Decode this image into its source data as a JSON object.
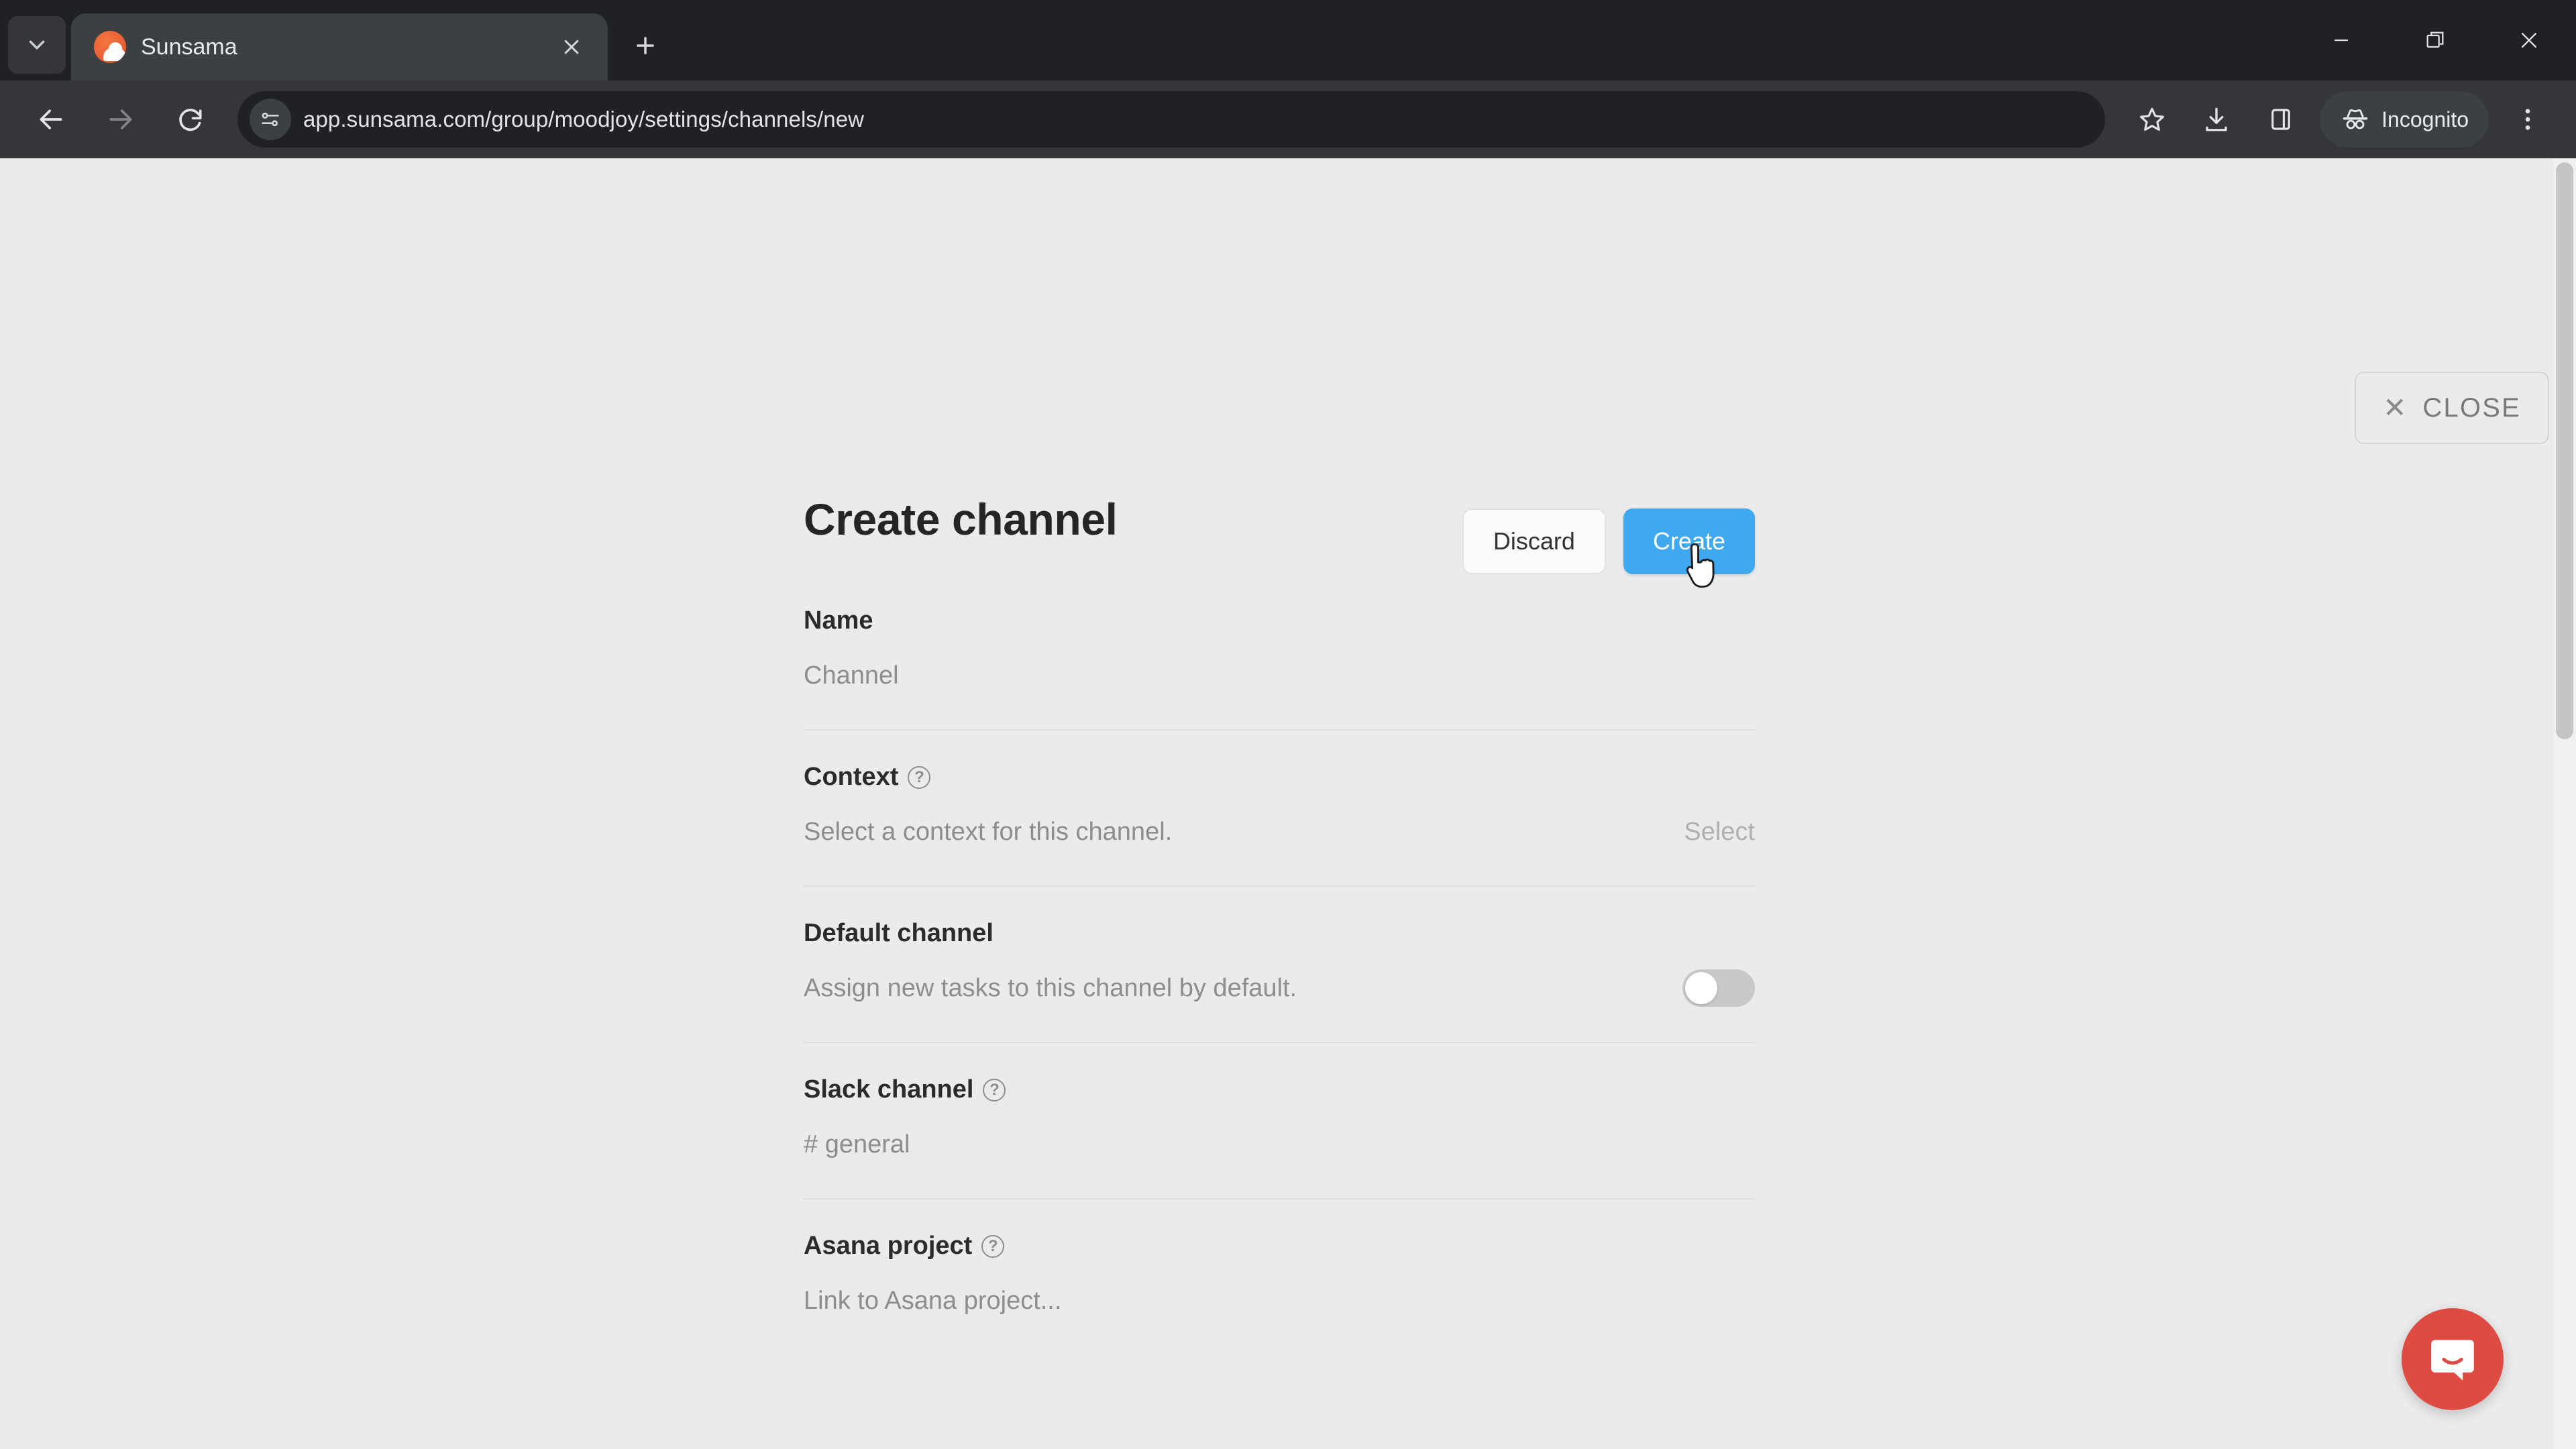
{
  "browser": {
    "tab": {
      "title": "Sunsama",
      "favicon": "sunsama-logo-icon"
    },
    "tab_search_icon": "chevron-down-icon",
    "new_tab_icon": "plus-icon",
    "tab_close_icon": "close-icon",
    "window": {
      "minimize": "minimize-icon",
      "maximize": "restore-icon",
      "close": "close-icon"
    },
    "nav": {
      "back": "back-arrow-icon",
      "forward": "forward-arrow-icon",
      "reload": "reload-icon"
    },
    "omnibox": {
      "site_settings_icon": "tune-icon",
      "url": "app.sunsama.com/group/moodjoy/settings/channels/new"
    },
    "actions": {
      "bookmark_icon": "star-icon",
      "downloads_icon": "download-icon",
      "side_panel_icon": "side-panel-icon",
      "menu_icon": "three-dot-menu-icon",
      "incognito_label": "Incognito",
      "incognito_icon": "incognito-icon"
    }
  },
  "page": {
    "close_button": {
      "label": "CLOSE",
      "icon": "close-x-icon"
    },
    "title": "Create channel",
    "buttons": {
      "discard": "Discard",
      "create": "Create"
    },
    "accent_color": "#3fa9f0",
    "rows": [
      {
        "label": "Name",
        "has_help": false,
        "placeholder": "Channel",
        "right": ""
      },
      {
        "label": "Context",
        "has_help": true,
        "description": "Select a context for this channel.",
        "right": "Select"
      },
      {
        "label": "Default channel",
        "has_help": false,
        "description": "Assign new tasks to this channel by default.",
        "toggle": "off"
      },
      {
        "label": "Slack channel",
        "has_help": true,
        "placeholder": "# general",
        "right": ""
      },
      {
        "label": "Asana project",
        "has_help": true,
        "placeholder": "Link to Asana project...",
        "right": ""
      }
    ],
    "intercom_icon": "intercom-messenger-icon",
    "cursor": "pointer-hand-cursor"
  }
}
